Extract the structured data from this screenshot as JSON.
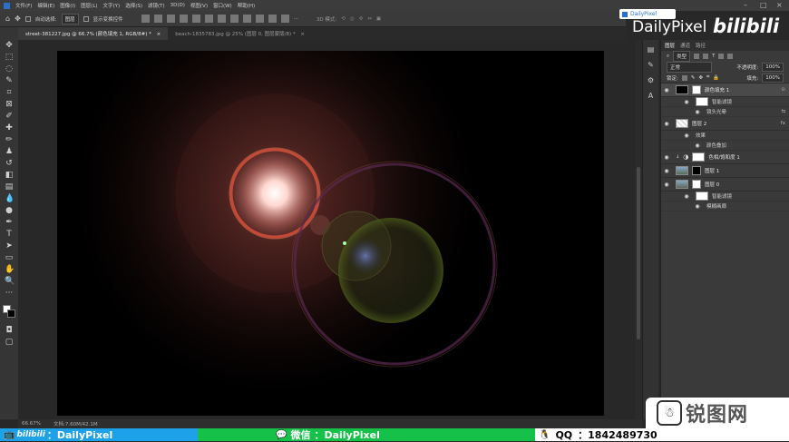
{
  "menubar": {
    "items": [
      "文件(F)",
      "编辑(E)",
      "图像(I)",
      "图层(L)",
      "文字(Y)",
      "选择(S)",
      "滤镜(T)",
      "3D(D)",
      "视图(V)",
      "窗口(W)",
      "帮助(H)"
    ]
  },
  "options_bar": {
    "auto_select_label": "自动选择:",
    "auto_select_value": "图层",
    "show_transform_label": "显示变换控件"
  },
  "branding": {
    "badge_text": "DailyPixel",
    "main": "DailyPixel",
    "logo": "bilibili"
  },
  "doc_tabs": [
    {
      "label": "street-381227.jpg @ 66.7% (颜色填充 1, RGB/8#) *",
      "active": true
    },
    {
      "label": "beach-1835783.jpg @ 25% (图层 0, 图层蒙版/8) *",
      "active": false
    }
  ],
  "status": {
    "zoom": "66.67%",
    "doc_size": "文档:7.60M/42.1M"
  },
  "layers_panel": {
    "tabs": [
      "图层",
      "通道",
      "路径"
    ],
    "filter_label": "类型",
    "blend_mode": "正常",
    "opacity_label": "不透明度:",
    "opacity_value": "100%",
    "lock_label": "锁定:",
    "fill_label": "填充:",
    "fill_value": "100%",
    "layers": [
      {
        "name": "颜色填充 1",
        "selected": true
      },
      {
        "sub": "智能滤镜"
      },
      {
        "sub2": "镜头光晕"
      },
      {
        "name": "图层 2"
      },
      {
        "sub": "效果"
      },
      {
        "sub2": "颜色叠加"
      },
      {
        "name": "色相/饱和度 1"
      },
      {
        "name": "图层 1"
      },
      {
        "name": "图层 0"
      },
      {
        "sub": "智能滤镜"
      },
      {
        "sub2": "模糊画廊"
      }
    ]
  },
  "footer": {
    "bilibili": "bilibili",
    "bilibili_id": "：DailyPixel",
    "wechat_label": "微信",
    "wechat_id": "：DailyPixel",
    "qq_label": "QQ",
    "qq_number": "：1842489730"
  },
  "watermark": {
    "site": "锐图网"
  },
  "colors": {
    "accent_blue": "#1da1e8",
    "accent_green": "#16c14a",
    "panel": "#3a3a3a"
  }
}
